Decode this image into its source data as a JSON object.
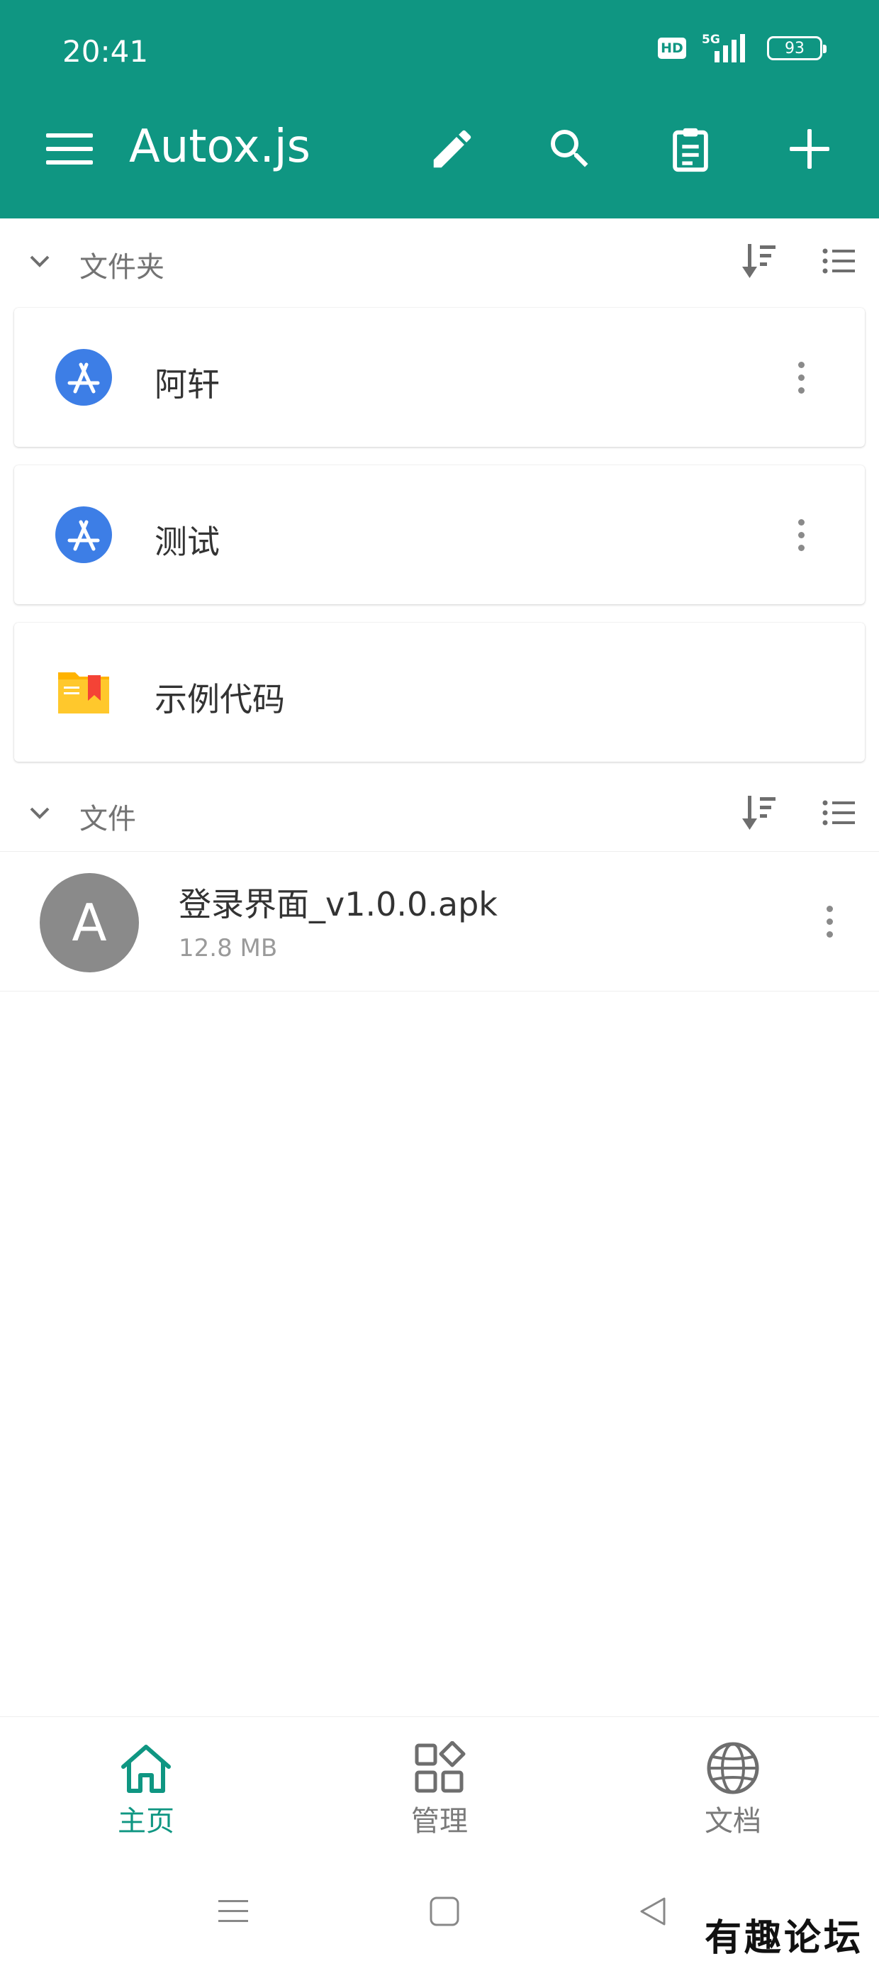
{
  "status_bar": {
    "time": "20:41",
    "hd_badge": "HD",
    "network": "5G",
    "battery": "93"
  },
  "toolbar": {
    "title": "Autox.js",
    "icons": [
      "menu-icon",
      "edit-icon",
      "search-icon",
      "clipboard-icon",
      "add-icon"
    ]
  },
  "sections": {
    "folders": {
      "label": "文件夹"
    },
    "files": {
      "label": "文件"
    }
  },
  "folders": [
    {
      "label": "阿轩",
      "icon": "app-store-icon"
    },
    {
      "label": "测试",
      "icon": "app-store-icon"
    },
    {
      "label": "示例代码",
      "icon": "folder-bookmark-icon"
    }
  ],
  "files": [
    {
      "avatar_letter": "A",
      "name": "登录界面_v1.0.0.apk",
      "size": "12.8 MB"
    }
  ],
  "bottom_nav": [
    {
      "label": "主页",
      "icon": "home-icon",
      "active": true
    },
    {
      "label": "管理",
      "icon": "grid-icon",
      "active": false
    },
    {
      "label": "文档",
      "icon": "globe-icon",
      "active": false
    }
  ],
  "watermark": "有趣论坛",
  "colors": {
    "primary": "#0f9682",
    "app_store_blue": "#3d7ee6",
    "folder_yellow": "#ffc107",
    "bookmark_red": "#f44336",
    "avatar_gray": "#8a8a8a"
  }
}
